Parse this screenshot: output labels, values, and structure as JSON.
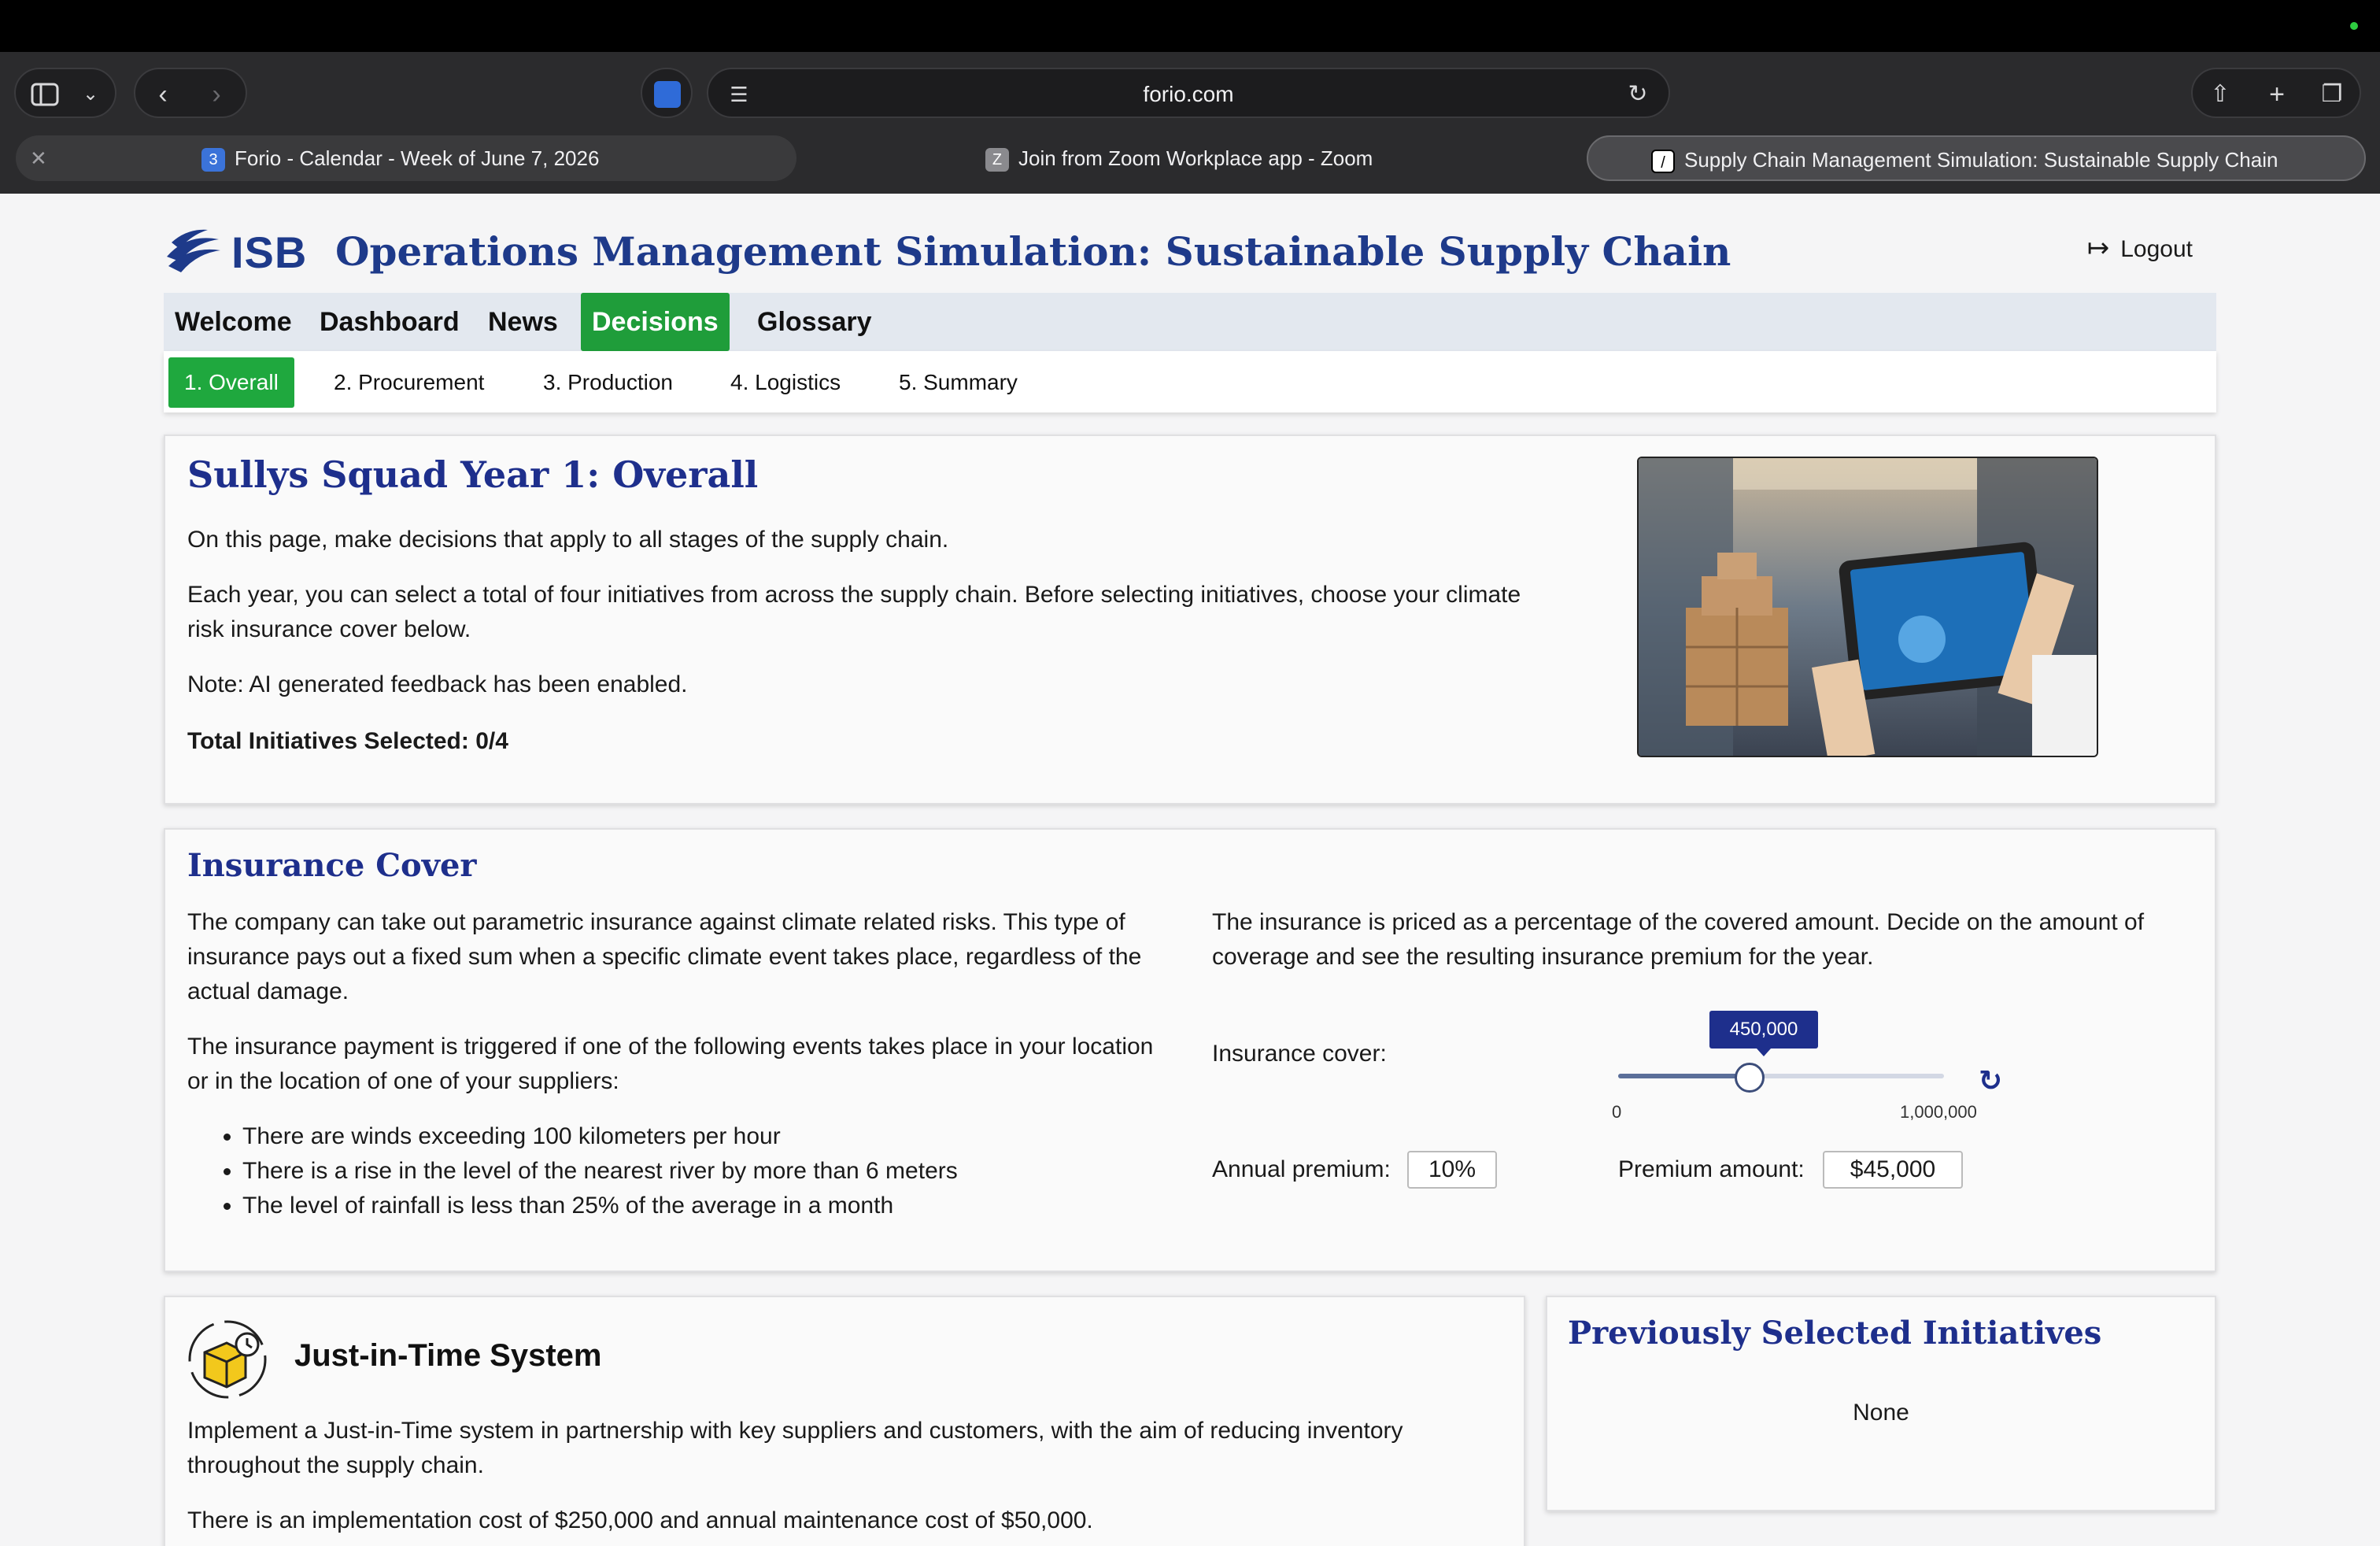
{
  "browser": {
    "url": "forio.com",
    "tabs": [
      {
        "label": "Forio - Calendar - Week of June 7, 2026",
        "favicon": "3"
      },
      {
        "label": "Join from Zoom Workplace app - Zoom",
        "favicon": "Z"
      },
      {
        "label": "Supply Chain Management Simulation: Sustainable Supply Chain",
        "favicon": "/"
      }
    ]
  },
  "header": {
    "logo": "ISB",
    "title": "Operations Management Simulation: Sustainable Supply Chain",
    "logout": "Logout"
  },
  "mainnav": [
    "Welcome",
    "Dashboard",
    "News",
    "Decisions",
    "Glossary"
  ],
  "subnav": [
    "1. Overall",
    "2. Procurement",
    "3. Production",
    "4. Logistics",
    "5. Summary"
  ],
  "overview": {
    "title": "Sullys Squad Year 1: Overall",
    "p1": "On this page, make decisions that apply to all stages of the supply chain.",
    "p2": "Each year, you can select a total of four initiatives from across the supply chain. Before selecting initiatives, choose your climate risk insurance cover below.",
    "p3": "Note: AI generated feedback has been enabled.",
    "p4": "Total Initiatives Selected: 0/4"
  },
  "insurance": {
    "title": "Insurance Cover",
    "lp1": "The company can take out parametric insurance against climate related risks. This type of insurance pays out a fixed sum when a specific climate event takes place, regardless of the actual damage.",
    "lp2": "The insurance payment is triggered if one of the following events takes place in your location or in the location of one of your suppliers:",
    "bullets": [
      "There are winds exceeding 100 kilometers per hour",
      "There is a rise in the level of the nearest river by more than 6 meters",
      "The level of rainfall is less than 25% of the average in a month"
    ],
    "rp1": "The insurance is priced as a percentage of the covered amount. Decide on the amount of coverage and see the resulting insurance premium for the year.",
    "cover_label": "Insurance cover:",
    "slider_value": "450,000",
    "slider_fraction": 0.45,
    "slider_min": "0",
    "slider_max": "1,000,000",
    "premium_label": "Annual premium:",
    "premium_value": "10%",
    "amount_label": "Premium amount:",
    "amount_value": "$45,000"
  },
  "initiative": {
    "title": "Just-in-Time System",
    "p1": "Implement a Just-in-Time system in partnership with key suppliers and customers, with the aim of reducing inventory throughout the supply chain.",
    "p2": "There is an implementation cost of $250,000 and annual maintenance cost of $50,000."
  },
  "previous": {
    "title": "Previously Selected Initiatives",
    "none": "None"
  },
  "colors": {
    "brand_blue": "#1e2f8c",
    "active_green": "#1f9d3a"
  }
}
